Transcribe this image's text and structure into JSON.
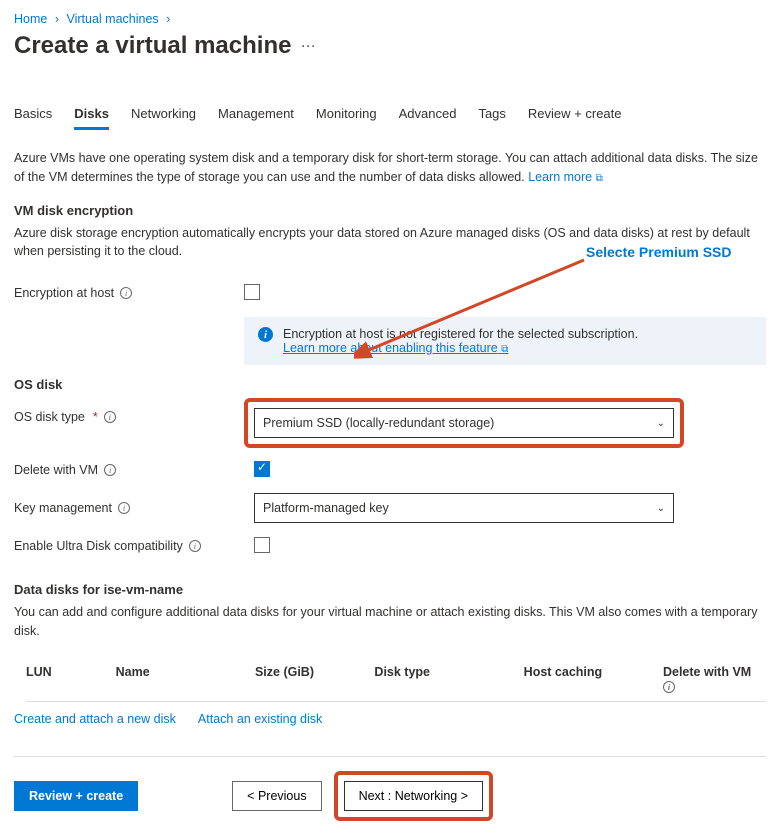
{
  "breadcrumb": {
    "home": "Home",
    "vm": "Virtual machines"
  },
  "page_title": "Create a virtual machine",
  "tabs": [
    "Basics",
    "Disks",
    "Networking",
    "Management",
    "Monitoring",
    "Advanced",
    "Tags",
    "Review + create"
  ],
  "intro": "Azure VMs have one operating system disk and a temporary disk for short-term storage. You can attach additional data disks. The size of the VM determines the type of storage you can use and the number of data disks allowed. ",
  "learn_more": "Learn more",
  "encryption": {
    "heading": "VM disk encryption",
    "desc": "Azure disk storage encryption automatically encrypts your data stored on Azure managed disks (OS and data disks) at rest by default when persisting it to the cloud.",
    "host_label": "Encryption at host",
    "banner_text": "Encryption at host is not registered for the selected subscription.",
    "banner_link": "Learn more about enabling this feature"
  },
  "osdisk": {
    "heading": "OS disk",
    "type_label": "OS disk type",
    "type_value": "Premium SSD (locally-redundant storage)",
    "delete_label": "Delete with VM",
    "key_label": "Key management",
    "key_value": "Platform-managed key",
    "ultra_label": "Enable Ultra Disk compatibility"
  },
  "datadisks": {
    "heading": "Data disks for ise-vm-name",
    "desc": "You can add and configure additional data disks for your virtual machine or attach existing disks. This VM also comes with a temporary disk.",
    "cols": {
      "lun": "LUN",
      "name": "Name",
      "size": "Size (GiB)",
      "type": "Disk type",
      "cache": "Host caching",
      "delete": "Delete with VM"
    },
    "create_link": "Create and attach a new disk",
    "attach_link": "Attach an existing disk"
  },
  "footer": {
    "review": "Review + create",
    "prev": "< Previous",
    "next": "Next : Networking >"
  },
  "callout": "Selecte Premium SSD"
}
